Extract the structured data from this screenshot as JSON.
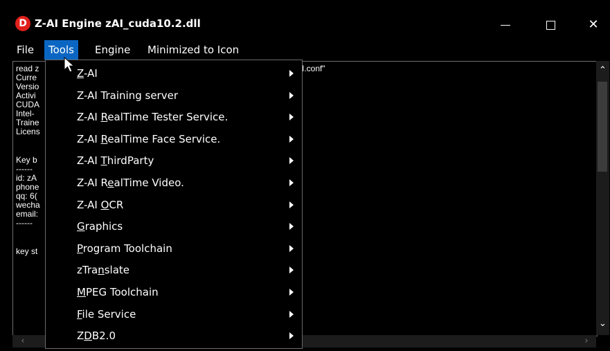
{
  "window": {
    "title": "Z-AI Engine zAI_cuda10.2.dll",
    "app_icon_letter": "D"
  },
  "menubar": {
    "items": [
      "File",
      "Tools",
      "Engine",
      "Minimized to Icon"
    ],
    "active": "Tools"
  },
  "log": {
    "lines": [
      "read z",
      "Curre",
      "Versio",
      "Activi",
      "CUDA",
      "Intel-",
      "Traine",
      "Licens",
      "",
      "Key b",
      "------",
      "id: zA",
      "phone",
      "qq: 6(",
      "wecha",
      "email:",
      "------",
      "",
      "key st"
    ],
    "conf_fragment": "I.conf\""
  },
  "tools_menu": {
    "items": [
      {
        "label": "Z-AI",
        "mnemonic": "Z"
      },
      {
        "label": "Z-AI Training server",
        "mnemonic": "A"
      },
      {
        "label": "Z-AI RealTime Tester Service.",
        "mnemonic": "R"
      },
      {
        "label": "Z-AI RealTime Face Service.",
        "mnemonic": "R"
      },
      {
        "label": "Z-AI ThirdParty",
        "mnemonic": "T"
      },
      {
        "label": "Z-AI RealTime Video.",
        "mnemonic": "e"
      },
      {
        "label": "Z-AI OCR",
        "mnemonic": "O"
      },
      {
        "label": "Graphics",
        "mnemonic": "G"
      },
      {
        "label": "Program Toolchain",
        "mnemonic": "P"
      },
      {
        "label": "zTranslate",
        "mnemonic": "n"
      },
      {
        "label": "MPEG Toolchain",
        "mnemonic": "M"
      },
      {
        "label": "File Service",
        "mnemonic": "F"
      },
      {
        "label": "ZDB2.0",
        "mnemonic": "D"
      }
    ]
  },
  "colors": {
    "menu_highlight": "#0b66c3",
    "app_icon": "#e0201b",
    "background": "#000000",
    "text": "#ffffff"
  }
}
